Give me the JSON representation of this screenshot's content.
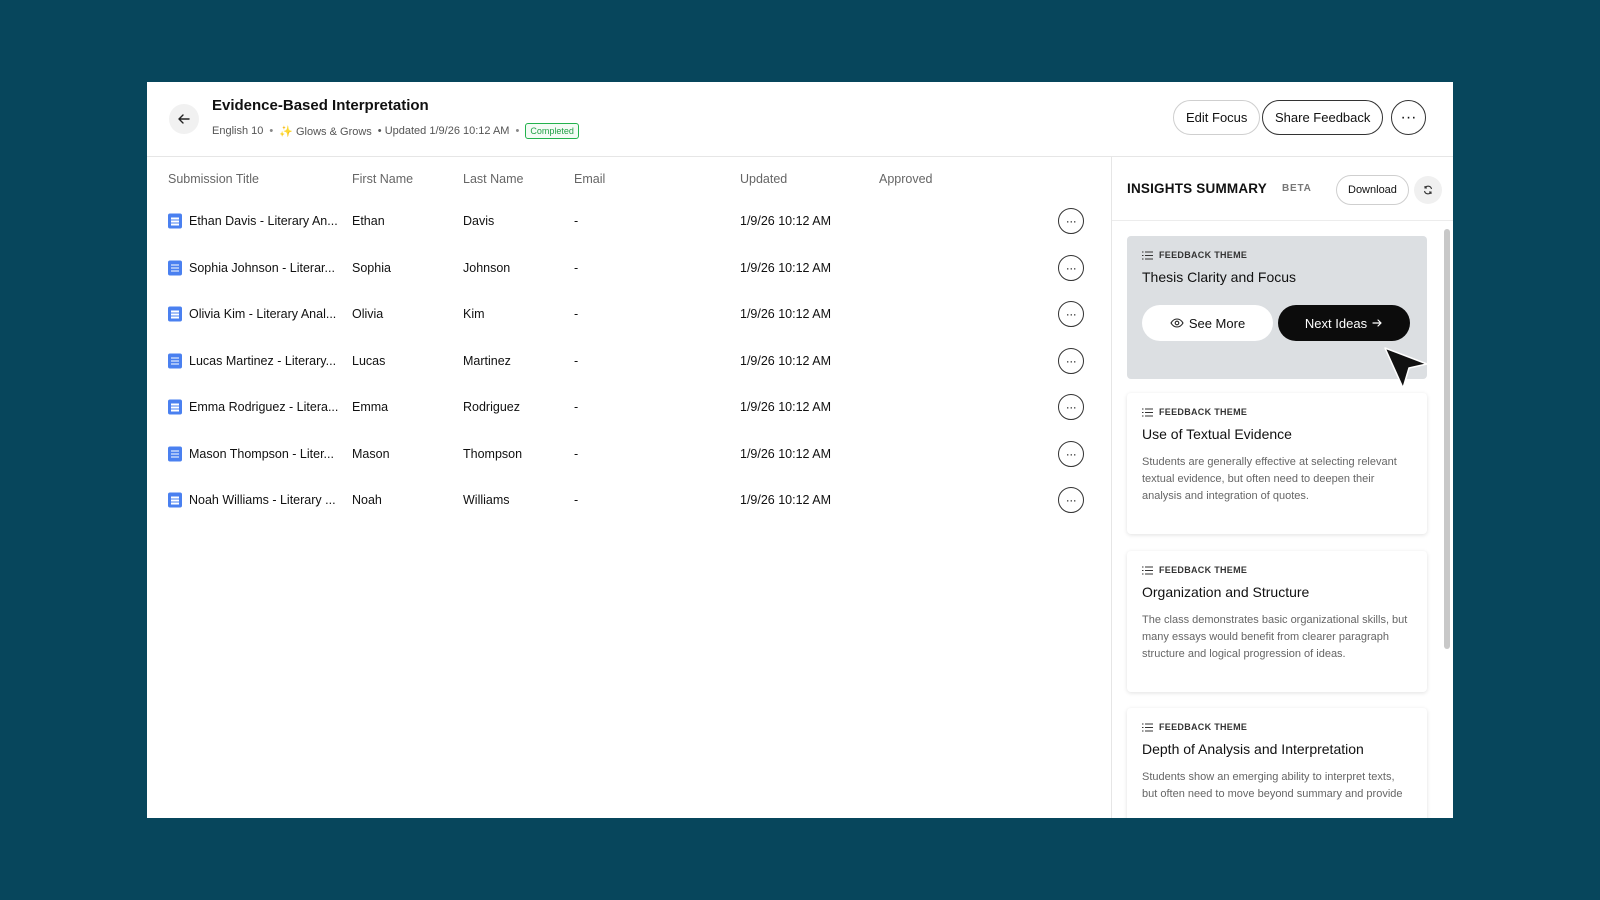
{
  "header": {
    "title": "Evidence-Based Interpretation",
    "course": "English 10",
    "separator": "•",
    "focus": "Glows & Grows",
    "updated": "• Updated 1/9/26 10:12 AM",
    "status": "Completed",
    "edit_focus_label": "Edit Focus",
    "share_feedback_label": "Share Feedback",
    "more_label": "···"
  },
  "table": {
    "columns": [
      "Submission Title",
      "First Name",
      "Last Name",
      "Email",
      "Updated",
      "Approved"
    ],
    "rows": [
      {
        "title": "Ethan Davis - Literary An...",
        "first": "Ethan",
        "last": "Davis",
        "email": "-",
        "updated": "1/9/26 10:12 AM",
        "approved": ""
      },
      {
        "title": "Sophia Johnson - Literar...",
        "first": "Sophia",
        "last": "Johnson",
        "email": "-",
        "updated": "1/9/26 10:12 AM",
        "approved": ""
      },
      {
        "title": "Olivia Kim - Literary Anal...",
        "first": "Olivia",
        "last": "Kim",
        "email": "-",
        "updated": "1/9/26 10:12 AM",
        "approved": ""
      },
      {
        "title": "Lucas Martinez - Literary...",
        "first": "Lucas",
        "last": "Martinez",
        "email": "-",
        "updated": "1/9/26 10:12 AM",
        "approved": ""
      },
      {
        "title": "Emma Rodriguez - Litera...",
        "first": "Emma",
        "last": "Rodriguez",
        "email": "-",
        "updated": "1/9/26 10:12 AM",
        "approved": ""
      },
      {
        "title": "Mason Thompson - Liter...",
        "first": "Mason",
        "last": "Thompson",
        "email": "-",
        "updated": "1/9/26 10:12 AM",
        "approved": ""
      },
      {
        "title": "Noah Williams - Literary ...",
        "first": "Noah",
        "last": "Williams",
        "email": "-",
        "updated": "1/9/26 10:12 AM",
        "approved": ""
      }
    ],
    "row_more_label": "···"
  },
  "sidebar": {
    "title": "INSIGHTS SUMMARY",
    "beta": "BETA",
    "download_label": "Download",
    "kicker": "FEEDBACK THEME",
    "see_more_label": "See More",
    "next_ideas_label": "Next Ideas",
    "cards": [
      {
        "title": "Thesis Clarity and Focus",
        "desc": ""
      },
      {
        "title": "Use of Textual Evidence",
        "desc": "Students are generally effective at selecting relevant textual evidence, but often need to deepen their analysis and integration of quotes."
      },
      {
        "title": "Organization and Structure",
        "desc": "The class demonstrates basic organizational skills, but many essays would benefit from clearer paragraph structure and logical progression of ideas."
      },
      {
        "title": "Depth of Analysis and Interpretation",
        "desc": "Students show an emerging ability to interpret texts, but often need to move beyond summary and provide"
      }
    ]
  },
  "colors": {
    "background": "#07465c",
    "doc_icon": "#4a80f0",
    "status_green": "#22a046",
    "active_card": "#dcdfe2"
  },
  "icons": {
    "back": "arrow-left-icon",
    "doc": "document-icon",
    "sparkle": "sparkle-icon",
    "list": "list-icon",
    "eye": "eye-icon",
    "arrow_right": "arrow-right-icon",
    "refresh": "refresh-icon",
    "cursor": "cursor-icon"
  }
}
